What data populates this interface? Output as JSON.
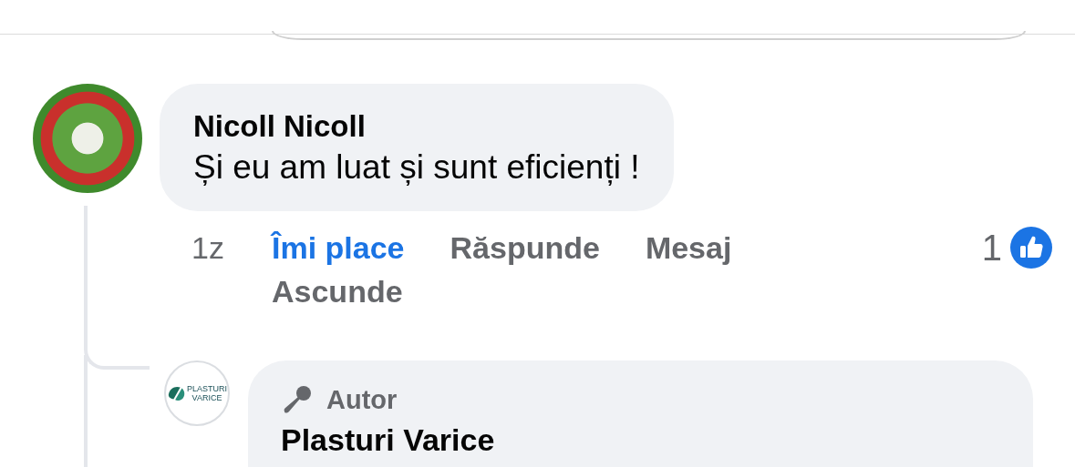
{
  "comment": {
    "author": "Nicoll Nicoll",
    "text": "Și eu am luat și sunt eficienți !",
    "time": "1z",
    "actions": [
      {
        "label": "Îmi place",
        "selected": true
      },
      {
        "label": "Răspunde",
        "selected": false
      },
      {
        "label": "Mesaj",
        "selected": false
      },
      {
        "label": "Ascunde",
        "selected": false
      }
    ],
    "reaction_count": "1"
  },
  "reply": {
    "avatar_logo": [
      "PLASTURI",
      "VARICE"
    ],
    "badge": "Autor",
    "author": "Plasturi Varice"
  }
}
